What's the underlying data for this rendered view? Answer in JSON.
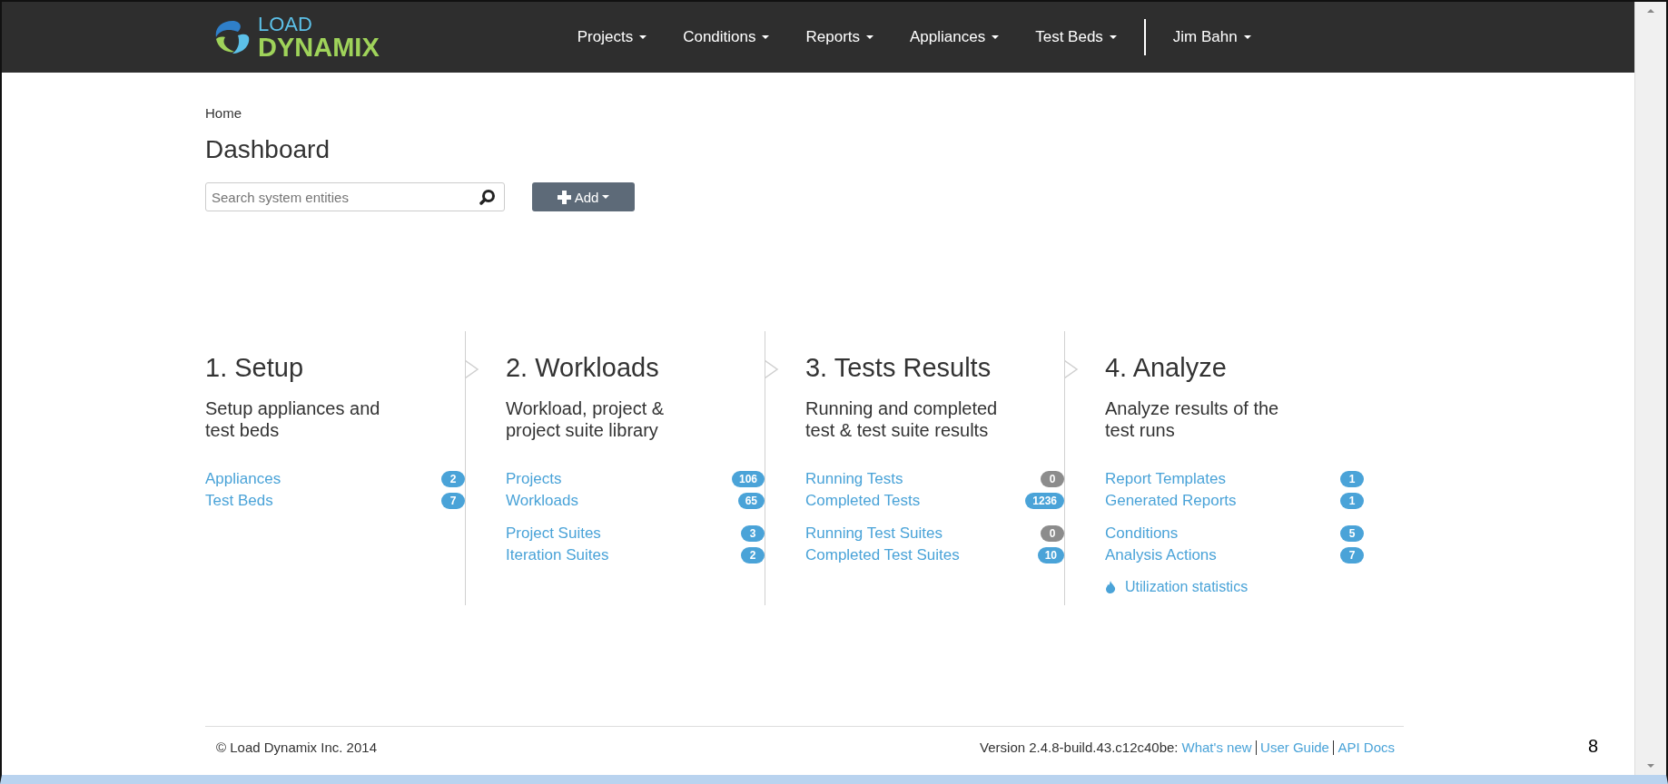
{
  "header": {
    "logo_top": "LOAD",
    "logo_bottom": "DYNAMIX",
    "nav": [
      "Projects",
      "Conditions",
      "Reports",
      "Appliances",
      "Test Beds"
    ],
    "user": "Jim Bahn"
  },
  "breadcrumb": "Home",
  "title": "Dashboard",
  "search": {
    "placeholder": "Search system entities"
  },
  "add_button": "Add",
  "steps": [
    {
      "title": "1. Setup",
      "description": "Setup appliances and test beds",
      "groups": [
        [
          {
            "label": "Appliances",
            "count": "2",
            "color": "#4aa3d8"
          },
          {
            "label": "Test Beds",
            "count": "7",
            "color": "#4aa3d8"
          }
        ]
      ]
    },
    {
      "title": "2. Workloads",
      "description": "Workload, project & project suite library",
      "groups": [
        [
          {
            "label": "Projects",
            "count": "106",
            "color": "#4aa3d8"
          },
          {
            "label": "Workloads",
            "count": "65",
            "color": "#4aa3d8"
          }
        ],
        [
          {
            "label": "Project Suites",
            "count": "3",
            "color": "#4aa3d8"
          },
          {
            "label": "Iteration Suites",
            "count": "2",
            "color": "#4aa3d8"
          }
        ]
      ]
    },
    {
      "title": "3. Tests Results",
      "description": "Running and completed test & test suite results",
      "groups": [
        [
          {
            "label": "Running Tests",
            "count": "0",
            "color": "#8c8c8c"
          },
          {
            "label": "Completed Tests",
            "count": "1236",
            "color": "#4aa3d8"
          }
        ],
        [
          {
            "label": "Running Test Suites",
            "count": "0",
            "color": "#8c8c8c"
          },
          {
            "label": "Completed Test Suites",
            "count": "10",
            "color": "#4aa3d8"
          }
        ]
      ]
    },
    {
      "title": "4. Analyze",
      "description": "Analyze results of the test runs",
      "groups": [
        [
          {
            "label": "Report Templates",
            "count": "1",
            "color": "#4aa3d8"
          },
          {
            "label": "Generated Reports",
            "count": "1",
            "color": "#4aa3d8"
          }
        ],
        [
          {
            "label": "Conditions",
            "count": "5",
            "color": "#4aa3d8"
          },
          {
            "label": "Analysis Actions",
            "count": "7",
            "color": "#4aa3d8"
          }
        ]
      ],
      "extra_link": "Utilization statistics"
    }
  ],
  "footer": {
    "copyright": "© Load Dynamix Inc. 2014",
    "version": "Version 2.4.8-build.43.c12c40be:",
    "links": [
      "What's new",
      "User Guide",
      "API Docs"
    ]
  },
  "page_number": "8"
}
